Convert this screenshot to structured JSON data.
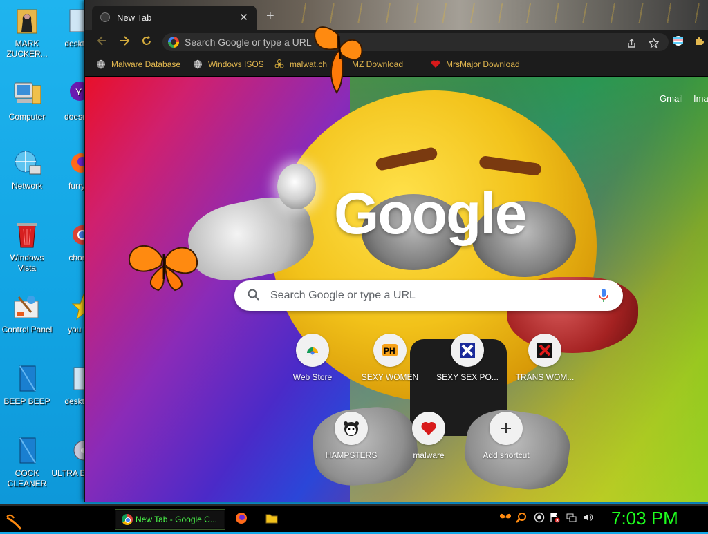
{
  "desktop": {
    "icons_col1": [
      {
        "label": "MARK ZUCKER...",
        "icon": "person-folder-icon"
      },
      {
        "label": "Computer",
        "icon": "computer-icon"
      },
      {
        "label": "Network",
        "icon": "network-icon"
      },
      {
        "label": "Windows Vista",
        "icon": "recycle-bin-icon"
      },
      {
        "label": "Control Panel",
        "icon": "control-panel-icon"
      },
      {
        "label": "BEEP BEEP",
        "icon": "blue-document-icon"
      },
      {
        "label": "COCK CLEANER",
        "icon": "blue-document-icon"
      }
    ],
    "icons_col2": [
      {
        "label": "deskto",
        "icon": "document-icon"
      },
      {
        "label": "doesnt",
        "icon": "yahoo-icon"
      },
      {
        "label": "furry",
        "icon": "firefox-icon"
      },
      {
        "label": "chor",
        "icon": "chrome-icon"
      },
      {
        "label": "you t",
        "icon": "star-icon"
      },
      {
        "label": "deskto",
        "icon": "document-icon"
      },
      {
        "label": "ULTRA BLOA",
        "icon": "disc-icon"
      }
    ]
  },
  "browser": {
    "tab": {
      "title": "New Tab",
      "close": "✕"
    },
    "new_tab_symbol": "+",
    "omnibox": {
      "placeholder": "Search Google or type a URL"
    },
    "bookmarks": [
      {
        "label": "Malware Database",
        "icon": "globe-icon"
      },
      {
        "label": "Windows ISOS",
        "icon": "globe-icon"
      },
      {
        "label": "malwat.ch",
        "icon": "biohazard-icon"
      },
      {
        "label": "MZ Download",
        "icon": "butterfly-icon"
      },
      {
        "label": "MrsMajor Download",
        "icon": "heart-icon"
      }
    ],
    "colors": {
      "accent": "#c8a03a",
      "bookmark_text": "#e3b84f"
    }
  },
  "ntp": {
    "links": {
      "gmail": "Gmail",
      "images": "Ima"
    },
    "logo": "Google",
    "search_placeholder": "Search Google or type a URL",
    "shortcuts": [
      {
        "label": "Web Store",
        "icon": "chrome-webstore-icon"
      },
      {
        "label": "SEXY WOMEN",
        "icon": "ph-icon"
      },
      {
        "label": "SEXY SEX PO...",
        "icon": "x-blue-icon"
      },
      {
        "label": "TRANS WOM...",
        "icon": "x-red-icon"
      },
      {
        "label": "HAMPSTERS",
        "icon": "hamster-icon"
      },
      {
        "label": "malware",
        "icon": "heart-icon"
      },
      {
        "label": "Add shortcut",
        "icon": "plus-icon"
      }
    ]
  },
  "taskbar": {
    "task_label": "New Tab - Google C...",
    "clock": "7:03 PM",
    "clock_color": "#1eff1e"
  }
}
